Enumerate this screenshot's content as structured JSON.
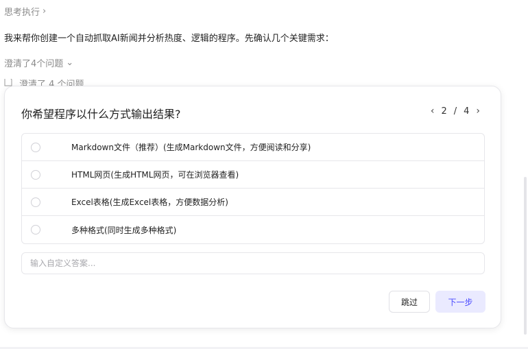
{
  "header": {
    "thinking_label": "思考执行",
    "assistant_message": "我来帮你创建一个自动抓取AI新闻并分析热度、逻辑的程序。先确认几个关键需求：",
    "clarified_label": "澄清了4个问题",
    "peek_label": "澄清了 4 个问题"
  },
  "dialog": {
    "question": "你希望程序以什么方式输出结果?",
    "pager": {
      "current": "2",
      "separator": "/",
      "total": "4"
    },
    "options": [
      {
        "label": "Markdown文件（推荐）(生成Markdown文件，方便阅读和分享)"
      },
      {
        "label": "HTML网页(生成HTML网页，可在浏览器查看)"
      },
      {
        "label": "Excel表格(生成Excel表格，方便数据分析)"
      },
      {
        "label": "多种格式(同时生成多种格式)"
      }
    ],
    "custom_placeholder": "输入自定义答案...",
    "skip_label": "跳过",
    "next_label": "下一步"
  },
  "icons": {
    "thinking_chevron": "chevron-right-icon",
    "clarified_chevron": "chevron-down-icon",
    "pager_prev": "chevron-left-icon",
    "pager_next": "chevron-right-icon",
    "doc": "document-icon"
  },
  "colors": {
    "accent": "#4b4bff",
    "accent_bg": "#eaeaff",
    "muted_text": "#8a8a8a",
    "border": "#e6e6ea"
  }
}
